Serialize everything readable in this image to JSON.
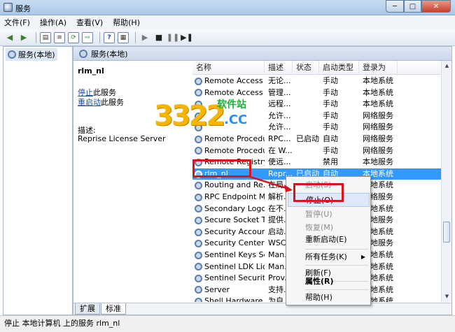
{
  "window": {
    "title": "服务",
    "min": "─",
    "max": "□",
    "close": "✕"
  },
  "menu": [
    "文件(F)",
    "操作(A)",
    "查看(V)",
    "帮助(H)"
  ],
  "left": {
    "tree_item": "服务(本地)"
  },
  "header": {
    "title": "服务(本地)"
  },
  "details": {
    "service_name": "rlm_nl",
    "stop_link": "停止",
    "stop_suffix": "此服务",
    "restart_link": "重启动",
    "restart_suffix": "此服务",
    "desc_label": "描述:",
    "desc_text": "Reprise License Server"
  },
  "table": {
    "columns": [
      "名称",
      "描述",
      "状态",
      "启动类型",
      "登录为"
    ],
    "rows": [
      [
        "Remote Access ...",
        "无论...",
        "",
        "手动",
        "本地系统"
      ],
      [
        "Remote Access ...",
        "管理...",
        "",
        "手动",
        "本地系统"
      ],
      [
        "",
        "远程...",
        "",
        "手动",
        "本地系统"
      ],
      [
        "",
        "允许...",
        "",
        "手动",
        "网络服务"
      ],
      [
        "",
        "允许...",
        "",
        "手动",
        "网络服务"
      ],
      [
        "Remote Procedu...",
        "RPC...",
        "已启动",
        "自动",
        "网络服务"
      ],
      [
        "Remote Procedu...",
        "在 W...",
        "",
        "手动",
        "网络服务"
      ],
      [
        "Remote Registry",
        "使远...",
        "",
        "禁用",
        "本地服务"
      ],
      [
        "rlm_nl",
        "Repr...",
        "已启动",
        "自动",
        "本地系统"
      ],
      [
        "Routing and Re...",
        "在局...",
        "",
        "",
        "本地系统"
      ],
      [
        "RPC Endpoint M...",
        "解析...",
        "",
        "",
        "网络服务"
      ],
      [
        "Secondary Logon",
        "在不...",
        "",
        "",
        "本地系统"
      ],
      [
        "Secure Socket T...",
        "提供...",
        "",
        "",
        "本地服务"
      ],
      [
        "Security Account...",
        "启动...",
        "",
        "",
        "本地系统"
      ],
      [
        "Security Center",
        "WSC...",
        "",
        "",
        "本地服务"
      ],
      [
        "Sentinel Keys Se...",
        "Man...",
        "",
        "",
        "本地系统"
      ],
      [
        "Sentinel LDK Lic...",
        "Man...",
        "",
        "",
        "本地系统"
      ],
      [
        "Sentinel Security...",
        "Prov...",
        "",
        "",
        "本地系统"
      ],
      [
        "Server",
        "支持...",
        "",
        "",
        "本地系统"
      ],
      [
        "Shell Hardware ...",
        "为自...",
        "",
        "",
        "本地系统"
      ]
    ],
    "selected_index": 8
  },
  "context_menu": {
    "start": "启动(S)",
    "stop": "停止(O)",
    "pause": "暂停(U)",
    "resume": "恢复(M)",
    "restart": "重新启动(E)",
    "all_tasks": "所有任务(K)",
    "refresh": "刷新(F)",
    "properties": "属性(R)",
    "help": "帮助(H)"
  },
  "tabs": [
    "扩展",
    "标准"
  ],
  "status": "停止 本地计算机 上的服务 rlm_nl",
  "watermark": {
    "digits": "3322",
    "brand": "软件站",
    "domain": ".CC"
  },
  "colors": {
    "selection": "#3399ff",
    "highlight_box": "#d9141b",
    "link": "#1a4ea0"
  }
}
